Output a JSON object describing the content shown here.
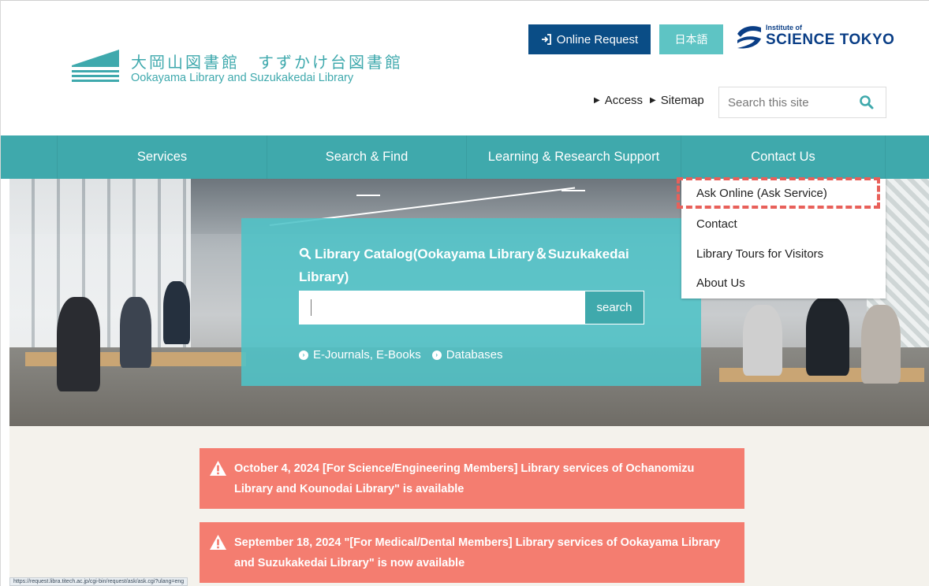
{
  "header": {
    "logo_ja": "大岡山図書館　すずかけ台図書館",
    "logo_en": "Ookayama Library and Suzukakedai Library",
    "online_request": "Online Request",
    "language": "日本語",
    "brand_small": "Institute of",
    "brand_big": "SCIENCE TOKYO",
    "access": "Access",
    "sitemap": "Sitemap",
    "search_placeholder": "Search this site"
  },
  "nav": {
    "items": [
      "Services",
      "Search & Find",
      "Learning & Research Support",
      "Contact Us"
    ]
  },
  "dropdown": {
    "items": [
      "Ask Online (Ask Service)",
      "Contact",
      "Library Tours for Visitors",
      "About Us"
    ]
  },
  "search_panel": {
    "title": "Library Catalog(Ookayama Library＆Suzukakedai Library)",
    "button": "search",
    "links": [
      "E-Journals, E-Books",
      "Databases"
    ]
  },
  "notices": [
    "October 4, 2024 [For Science/Engineering Members] Library services of Ochanomizu Library and Kounodai Library\" is available",
    "September 18, 2024 \"[For Medical/Dental Members] Library services of Ookayama Library and Suzukakedai Library\" is now available"
  ],
  "status_url": "https://request.libra.titech.ac.jp/cgi-bin/request/ask/ask.cgi?ulang=eng",
  "colors": {
    "teal": "#3fa9ac",
    "navy": "#0a4d86",
    "notice": "#f47d70",
    "highlight": "#e8605a"
  }
}
